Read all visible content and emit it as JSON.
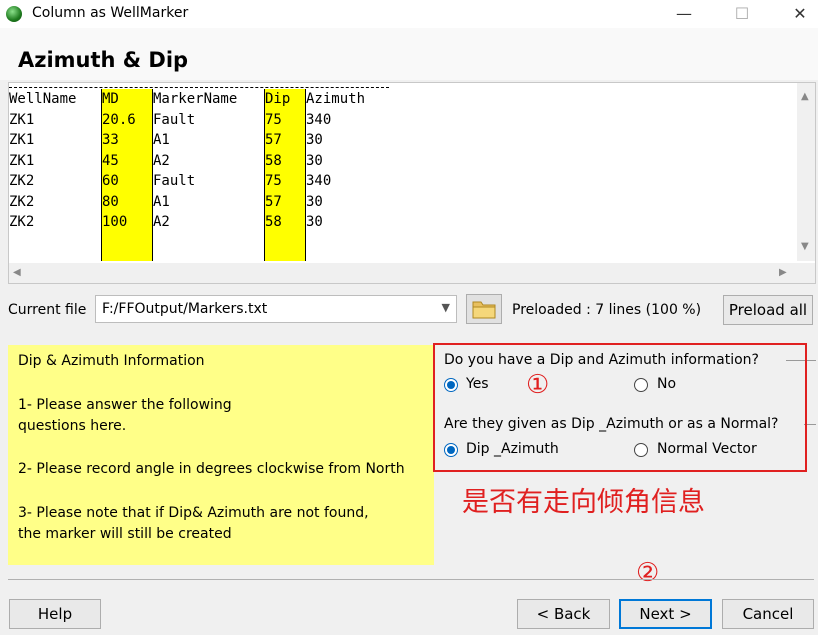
{
  "window": {
    "title": "Column as WellMarker",
    "minimize": "—",
    "maximize": "☐",
    "close": "✕"
  },
  "page_title": "Azimuth & Dip",
  "preview": {
    "columns": [
      {
        "header": "WellName",
        "cells": [
          "ZK1",
          "ZK1",
          "ZK1",
          "ZK2",
          "ZK2",
          "ZK2"
        ]
      },
      {
        "header": "MD",
        "cells": [
          "20.6",
          "33",
          "45",
          "60",
          "80",
          "100"
        ]
      },
      {
        "header": "MarkerName",
        "cells": [
          "Fault",
          "A1",
          "A2",
          "Fault",
          "A1",
          "A2"
        ]
      },
      {
        "header": "Dip",
        "cells": [
          "75",
          "57",
          "58",
          "75",
          "57",
          "58"
        ]
      },
      {
        "header": "Azimuth",
        "cells": [
          "340",
          "30",
          "30",
          "340",
          "30",
          "30"
        ]
      }
    ]
  },
  "file": {
    "label": "Current file",
    "value": "F:/FFOutput/Markers.txt",
    "preloaded": "Preloaded : 7 lines (100 %)",
    "preload_all": "Preload all"
  },
  "info": {
    "lines": [
      "Dip & Azimuth Information",
      "1- Please answer the following",
      "questions here.",
      "2- Please record angle in degrees clockwise from North",
      "3- Please note that if Dip& Azimuth are not found,",
      "the marker will still be created"
    ]
  },
  "questions": {
    "q1": "Do you have a Dip and Azimuth information?",
    "q1_yes": "Yes",
    "q1_no": "No",
    "q2": "Are they given as Dip _Azimuth or as a Normal?",
    "q2_opt1": "Dip _Azimuth",
    "q2_opt2": "Normal Vector"
  },
  "annotations": {
    "circle1": "①",
    "circle2": "②",
    "chinese_note": "是否有走向倾角信息"
  },
  "buttons": {
    "help": "Help",
    "back": "< Back",
    "next": "Next >",
    "cancel": "Cancel"
  },
  "colors": {
    "highlight": "#ffff00",
    "info_bg": "#ffff88",
    "annotation_red": "#e02020",
    "accent": "#0078d7"
  }
}
